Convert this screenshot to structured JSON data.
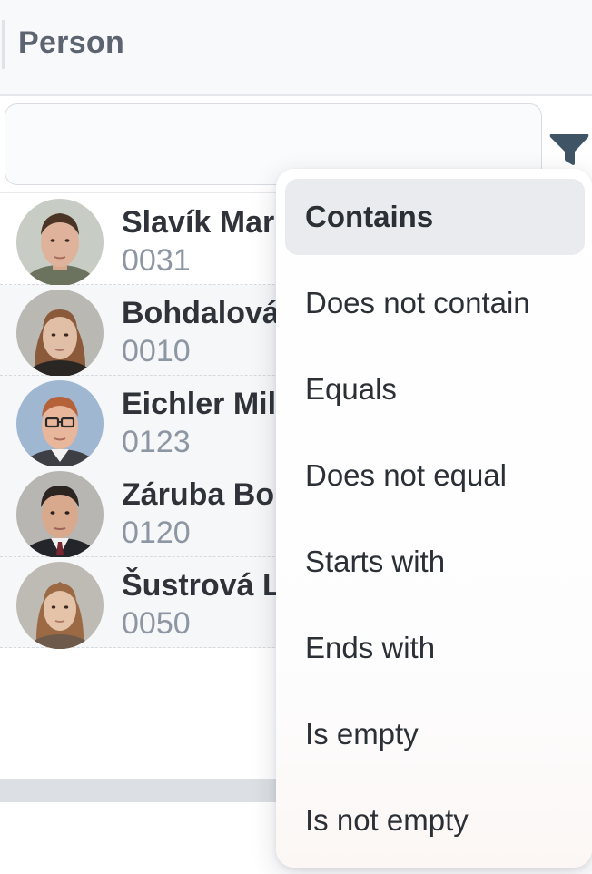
{
  "header": {
    "title": "Person"
  },
  "filter": {
    "value": "",
    "icon": "funnel-icon"
  },
  "rows": [
    {
      "name": "Slavík Mar",
      "code": "0031"
    },
    {
      "name": "Bohdalová",
      "code": "0010"
    },
    {
      "name": "Eichler Mil",
      "code": "0123"
    },
    {
      "name": "Záruba Bo",
      "code": "0120"
    },
    {
      "name": "Šustrová L",
      "code": "0050"
    }
  ],
  "menu": {
    "items": [
      {
        "label": "Contains",
        "selected": true
      },
      {
        "label": "Does not contain"
      },
      {
        "label": "Equals"
      },
      {
        "label": "Does not equal"
      },
      {
        "label": "Starts with"
      },
      {
        "label": "Ends with"
      },
      {
        "label": "Is empty"
      },
      {
        "label": "Is not empty"
      }
    ]
  },
  "colors": {
    "accent": "#3f5566",
    "selected_bg": "#e9ebee",
    "code_text": "#8d96a3"
  }
}
